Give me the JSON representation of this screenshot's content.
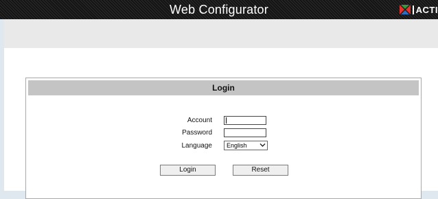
{
  "header": {
    "title": "Web Configurator",
    "logo_text": "ACTI"
  },
  "login_panel": {
    "title": "Login",
    "account_label": "Account",
    "account_value": "",
    "password_label": "Password",
    "password_value": "",
    "language_label": "Language",
    "language_selected": "English",
    "login_button": "Login",
    "reset_button": "Reset"
  },
  "icons": {
    "logo": "acti-logo-icon",
    "dropdown": "chevron-down-icon"
  }
}
